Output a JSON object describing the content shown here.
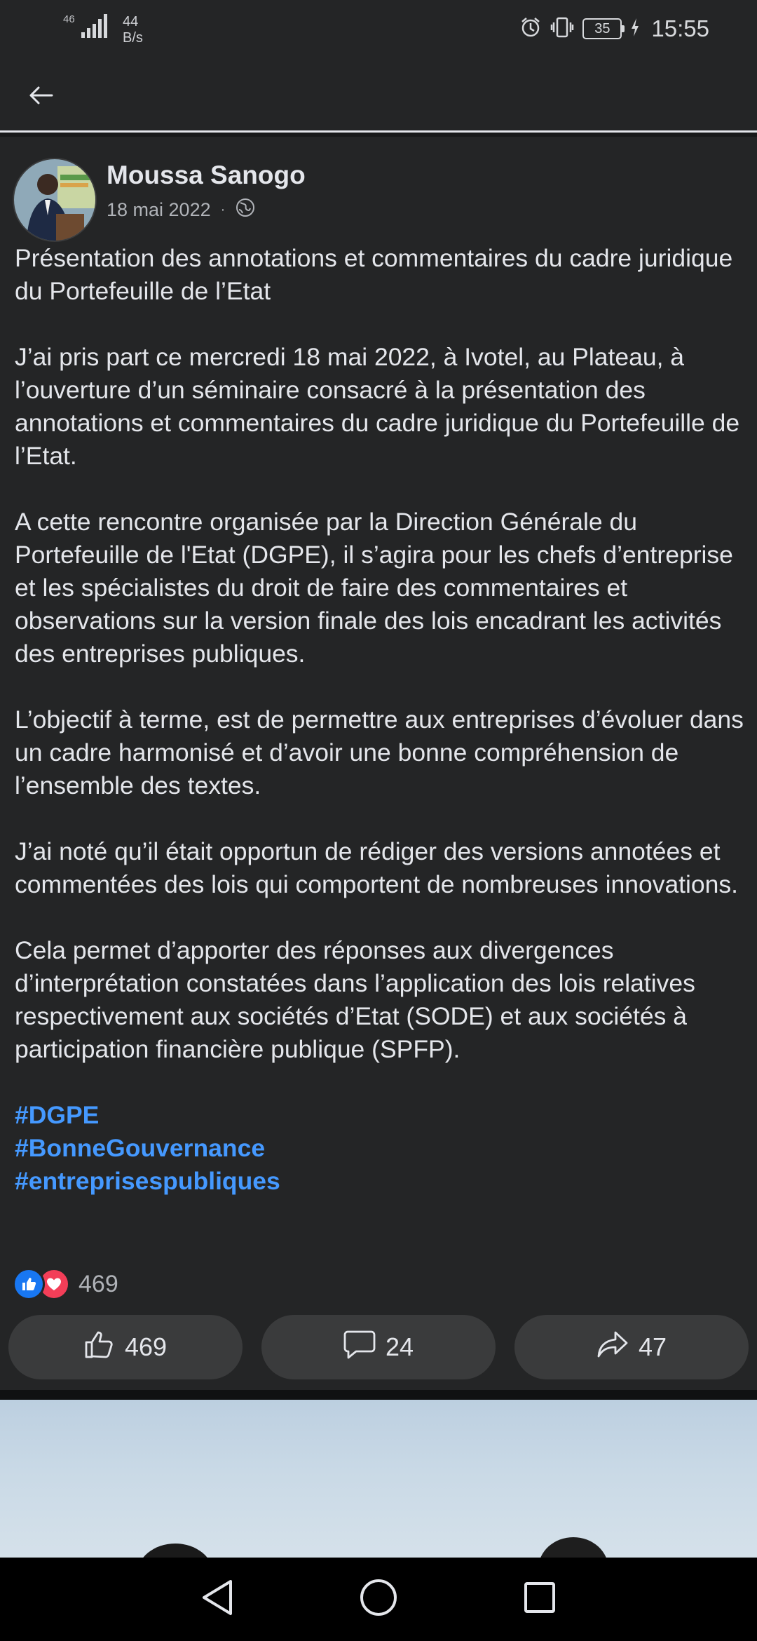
{
  "status_bar": {
    "network_type": "46",
    "net_speed_value": "44",
    "net_speed_unit": "B/s",
    "battery": "35",
    "time": "15:55"
  },
  "post": {
    "author": "Moussa Sanogo",
    "date": "18 mai 2022",
    "separator": "·",
    "paragraphs": [
      "Présentation des annotations et commentaires du cadre juridique du Portefeuille de l’Etat",
      "J’ai pris part ce mercredi 18 mai 2022, à Ivotel, au Plateau, à l’ouverture d’un séminaire consacré à la présentation des annotations et commentaires du cadre juridique du Portefeuille de l’Etat.",
      "A cette rencontre organisée par la Direction Générale du Portefeuille de l'Etat (DGPE), il s’agira pour les chefs d’entreprise et les spécialistes du droit de faire des commentaires et observations sur la version finale des lois encadrant les activités des entreprises publiques.",
      "L’objectif à terme, est de permettre aux entreprises d’évoluer dans un cadre harmonisé et d’avoir une bonne compréhension de l’ensemble des textes.",
      "J’ai noté qu’il était opportun de rédiger des versions annotées et commentées des lois qui comportent de nombreuses innovations.",
      "Cela permet d’apporter des réponses aux divergences d’interprétation constatées dans l’application des lois relatives respectivement aux sociétés d’Etat (SODE) et aux sociétés à participation financière publique (SPFP)."
    ],
    "hashtags": [
      "#DGPE",
      "#BonneGouvernance",
      "#entreprisespubliques"
    ],
    "reaction_count": "469",
    "actions": {
      "like_count": "469",
      "comment_count": "24",
      "share_count": "47"
    }
  },
  "colors": {
    "background": "#242526",
    "text": "#e4e6eb",
    "secondary_text": "#b0b3b8",
    "hashtag": "#4599ff",
    "like": "#1877f2",
    "love": "#f33e58"
  },
  "icons": {
    "back": "arrow-left-icon",
    "privacy": "globe-icon",
    "like": "thumbs-up-icon",
    "comment": "speech-bubble-icon",
    "share": "share-arrow-icon"
  }
}
